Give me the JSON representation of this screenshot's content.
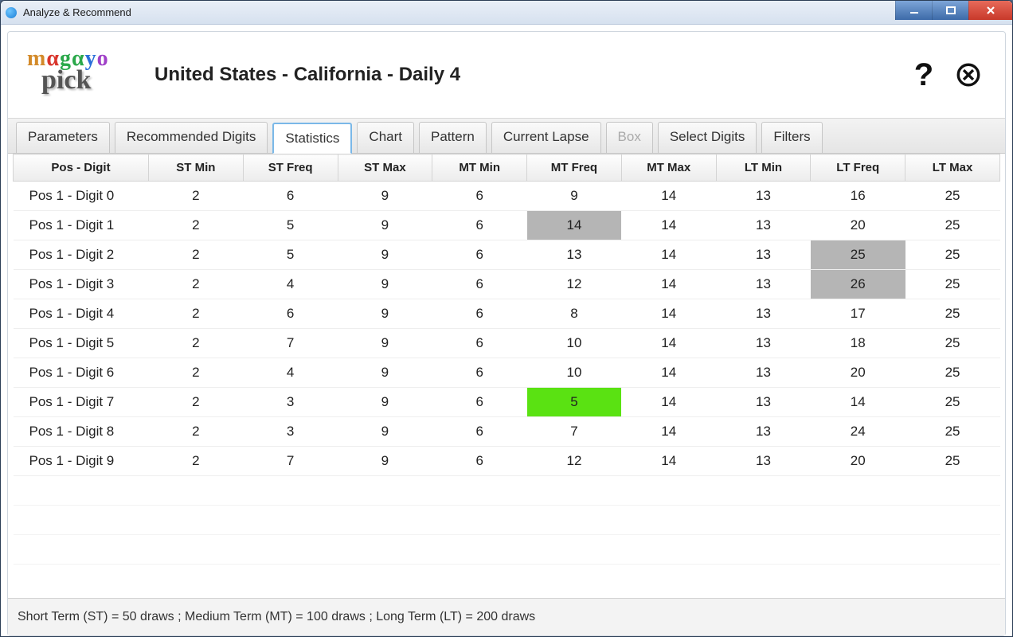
{
  "window": {
    "title": "Analyze & Recommend"
  },
  "header": {
    "logo_word1": "mαgαyo",
    "logo_word2": "pick",
    "page_title": "United States - California - Daily 4"
  },
  "tabs": [
    {
      "label": "Parameters",
      "state": "normal"
    },
    {
      "label": "Recommended Digits",
      "state": "normal"
    },
    {
      "label": "Statistics",
      "state": "active"
    },
    {
      "label": "Chart",
      "state": "normal"
    },
    {
      "label": "Pattern",
      "state": "normal"
    },
    {
      "label": "Current Lapse",
      "state": "normal"
    },
    {
      "label": "Box",
      "state": "disabled"
    },
    {
      "label": "Select Digits",
      "state": "normal"
    },
    {
      "label": "Filters",
      "state": "normal"
    }
  ],
  "columns": [
    "Pos - Digit",
    "ST Min",
    "ST Freq",
    "ST Max",
    "MT Min",
    "MT Freq",
    "MT Max",
    "LT Min",
    "LT Freq",
    "LT Max"
  ],
  "rows": [
    {
      "label": "Pos 1 - Digit 0",
      "st_min": 2,
      "st_freq": 6,
      "st_max": 9,
      "mt_min": 6,
      "mt_freq": 9,
      "mt_max": 14,
      "lt_min": 13,
      "lt_freq": 16,
      "lt_max": 25
    },
    {
      "label": "Pos 1 - Digit 1",
      "st_min": 2,
      "st_freq": 5,
      "st_max": 9,
      "mt_min": 6,
      "mt_freq": 14,
      "mt_max": 14,
      "lt_min": 13,
      "lt_freq": 20,
      "lt_max": 25,
      "hl": {
        "mt_freq": "grey"
      }
    },
    {
      "label": "Pos 1 - Digit 2",
      "st_min": 2,
      "st_freq": 5,
      "st_max": 9,
      "mt_min": 6,
      "mt_freq": 13,
      "mt_max": 14,
      "lt_min": 13,
      "lt_freq": 25,
      "lt_max": 25,
      "hl": {
        "lt_freq": "grey"
      }
    },
    {
      "label": "Pos 1 - Digit 3",
      "st_min": 2,
      "st_freq": 4,
      "st_max": 9,
      "mt_min": 6,
      "mt_freq": 12,
      "mt_max": 14,
      "lt_min": 13,
      "lt_freq": 26,
      "lt_max": 25,
      "hl": {
        "lt_freq": "grey"
      }
    },
    {
      "label": "Pos 1 - Digit 4",
      "st_min": 2,
      "st_freq": 6,
      "st_max": 9,
      "mt_min": 6,
      "mt_freq": 8,
      "mt_max": 14,
      "lt_min": 13,
      "lt_freq": 17,
      "lt_max": 25
    },
    {
      "label": "Pos 1 - Digit 5",
      "st_min": 2,
      "st_freq": 7,
      "st_max": 9,
      "mt_min": 6,
      "mt_freq": 10,
      "mt_max": 14,
      "lt_min": 13,
      "lt_freq": 18,
      "lt_max": 25
    },
    {
      "label": "Pos 1 - Digit 6",
      "st_min": 2,
      "st_freq": 4,
      "st_max": 9,
      "mt_min": 6,
      "mt_freq": 10,
      "mt_max": 14,
      "lt_min": 13,
      "lt_freq": 20,
      "lt_max": 25
    },
    {
      "label": "Pos 1 - Digit 7",
      "st_min": 2,
      "st_freq": 3,
      "st_max": 9,
      "mt_min": 6,
      "mt_freq": 5,
      "mt_max": 14,
      "lt_min": 13,
      "lt_freq": 14,
      "lt_max": 25,
      "hl": {
        "mt_freq": "green"
      }
    },
    {
      "label": "Pos 1 - Digit 8",
      "st_min": 2,
      "st_freq": 3,
      "st_max": 9,
      "mt_min": 6,
      "mt_freq": 7,
      "mt_max": 14,
      "lt_min": 13,
      "lt_freq": 24,
      "lt_max": 25
    },
    {
      "label": "Pos 1 - Digit 9",
      "st_min": 2,
      "st_freq": 7,
      "st_max": 9,
      "mt_min": 6,
      "mt_freq": 12,
      "mt_max": 14,
      "lt_min": 13,
      "lt_freq": 20,
      "lt_max": 25
    }
  ],
  "empty_rows": 3,
  "footer": "Short Term (ST) = 50 draws ; Medium Term (MT) = 100 draws ; Long Term (LT) = 200 draws"
}
